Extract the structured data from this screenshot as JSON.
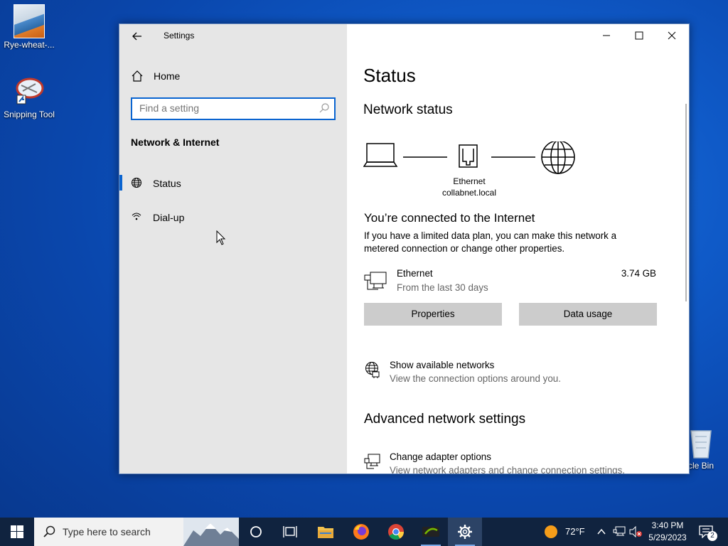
{
  "desktop": {
    "icons": [
      {
        "label": "Rye-wheat-..."
      },
      {
        "label": "Snipping Tool"
      },
      {
        "label": "cle Bin"
      }
    ]
  },
  "window": {
    "title": "Settings",
    "nav": {
      "home_label": "Home",
      "search_placeholder": "Find a setting",
      "section_title": "Network & Internet",
      "items": [
        {
          "label": "Status",
          "selected": true
        },
        {
          "label": "Dial-up",
          "selected": false
        }
      ]
    },
    "main": {
      "page_title": "Status",
      "network_status_heading": "Network status",
      "diagram": {
        "adapter_name": "Ethernet",
        "domain": "collabnet.local"
      },
      "connected_heading": "You’re connected to the Internet",
      "connected_text": "If you have a limited data plan, you can make this network a metered connection or change other properties.",
      "connection": {
        "name": "Ethernet",
        "period": "From the last 30 days",
        "usage": "3.74 GB"
      },
      "buttons": {
        "properties": "Properties",
        "data_usage": "Data usage"
      },
      "show_networks": {
        "title": "Show available networks",
        "subtitle": "View the connection options around you."
      },
      "advanced_heading": "Advanced network settings",
      "change_adapter": {
        "title": "Change adapter options",
        "subtitle": "View network adapters and change connection settings."
      }
    }
  },
  "taskbar": {
    "search_placeholder": "Type here to search",
    "weather": "72°F",
    "time": "3:40 PM",
    "date": "5/29/2023",
    "notification_count": "2"
  },
  "colors": {
    "accent": "#0a64d0",
    "taskbar": "#10233f",
    "nav_bg": "#e6e6e6"
  }
}
